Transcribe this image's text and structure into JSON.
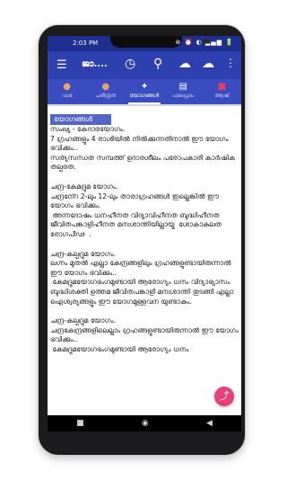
{
  "status": {
    "time": "2:03 PM",
    "icons": "⊛ ⏰ ◐ ▂▄▆ 🔋"
  },
  "appbar": {
    "title": "ജാ....",
    "menu_icon": "hamburger-icon"
  },
  "tabs": [
    {
      "label": "വശ",
      "icon": "●"
    },
    {
      "label": "ചരിത്രത",
      "icon": "●"
    },
    {
      "label": "യോഗങ്ങൾ",
      "icon": "✦"
    },
    {
      "label": "ഫലപ്രദം",
      "icon": "▤"
    },
    {
      "label": "ആഷ്",
      "icon": "■"
    }
  ],
  "content": {
    "heading": "യോഗങ്ങൾ",
    "blocks": [
      "സംഖ്യ - കേദാരയോഗം.\n7 ഗ്രഹങ്ങളും 4 രാശിയിൽ നിൽക്കുന്നതിനാൽ ഈ യോഗം ഭവിക്കും..\nസത്യസന്ധത സമ്പത്ത് ഉദാരശീലം പരോപകാരി കാർഷിക തല്പരത.",
      "ചന്ദ്ര-കേമദ്രുമ യോഗം.\nചന്ദ്രനേ്റ 2-ലും 12-ലും താരാഗ്രഹങ്ങൾ ഇല്ലെങ്കിൽ ഈ യോഗം ഭവിക്കും.\n അന്നദോഷം ധനഹീനത വിദ്യാവിഹീനത ബുദ്ധിഹീനത ജീവിതപങ്കാളിഹീനത മനഃശാന്തിയില്ലായ്മ  ശോകാകുലത രോഗപീഢ  .",
      "ചന്ദ്ര-കല്പദ്രുമ യോഗം.\nലഗ്നം മുതൽ എല്ലാ കേന്ദ്രങ്ങളിലും ഗ്രഹങ്ങളുണ്ടായിരുന്നാൽ ഈ യോഗം ഭവിക്കും..\n കേമദ്രുമയോഗഭംഗമുണ്ടായി ആരോഗ്യം ധനം വിദ്യാഭ്യാസം ബുദ്ധിശക്തി ഉത്തമ ജീവിതപങ്കാളി മനഃശാന്തി തുടങ്ങി എല്ലാ ഐശ്വര്യങ്ങളും ഈ യോഗമുള്ളവന യുണ്ടാകും.",
      "ചന്ദ്ര-കല്പദ്രുമ യോഗം.\nചന്ദ്രകേന്ദ്രങ്ങളിലെല്ലാം ഗ്രഹങ്ങളുണ്ടായിരുന്നാൽ ഈ യോഗം ഭവിക്കും..\n കേമദ്രുമയോഗഭംഗമുണ്ടായി ആരോഗ്യം ധനം"
    ]
  },
  "fab_icon": "share-icon",
  "nav": {
    "back": "◀",
    "home": "◉",
    "recent": "■"
  }
}
